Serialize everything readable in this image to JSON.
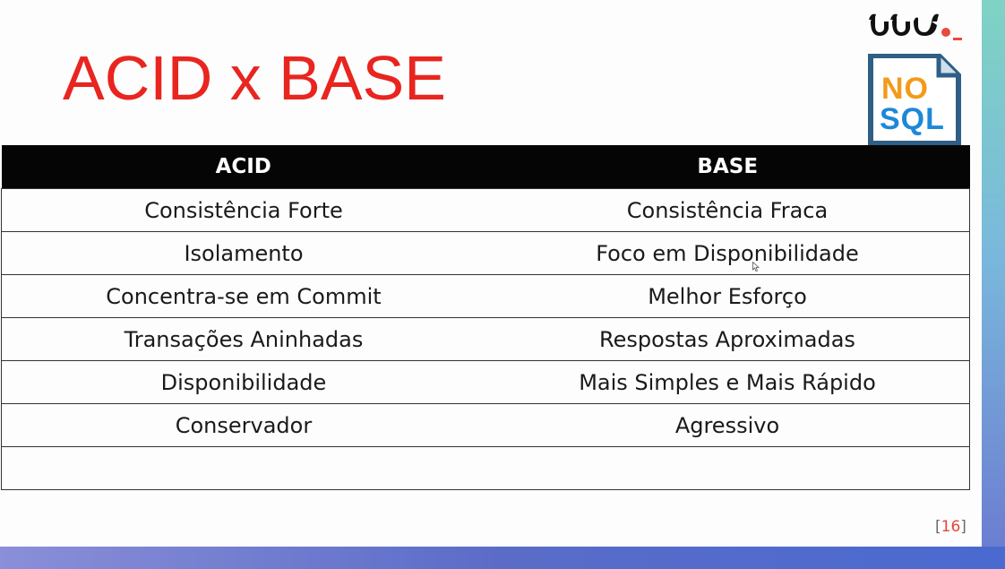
{
  "slide": {
    "title": "ACID x BASE",
    "page_open": "[",
    "page_number": "16",
    "page_close": "]"
  },
  "logos": {
    "nosql_top": "NO",
    "nosql_bottom": "SQL"
  },
  "table": {
    "headers": [
      "ACID",
      "BASE"
    ],
    "rows": [
      [
        "Consistência Forte",
        "Consistência Fraca"
      ],
      [
        "Isolamento",
        "Foco em Disponibilidade"
      ],
      [
        "Concentra-se em Commit",
        "Melhor Esforço"
      ],
      [
        "Transações Aninhadas",
        "Respostas Aproximadas"
      ],
      [
        "Disponibilidade",
        "Mais Simples e Mais Rápido"
      ],
      [
        "Conservador",
        "Agressivo"
      ],
      [
        "",
        ""
      ]
    ]
  },
  "colors": {
    "title": "#e8251f",
    "header_bg": "#050505",
    "nosql_orange": "#f39a1b",
    "nosql_blue": "#1e88d8",
    "brand_accent": "#e84a3c"
  },
  "icons": {
    "brand": "uni-brand-logo",
    "nosql": "nosql-document-icon",
    "cursor": "mouse-pointer-icon"
  }
}
